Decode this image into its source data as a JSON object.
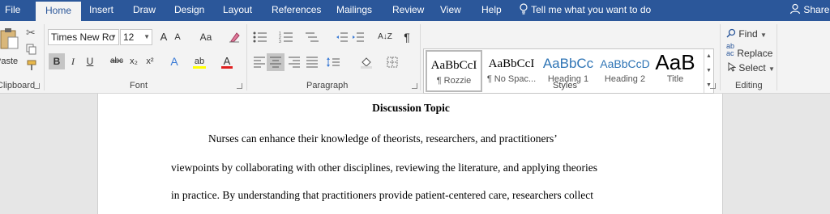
{
  "tabs": [
    "File",
    "Home",
    "Insert",
    "Draw",
    "Design",
    "Layout",
    "References",
    "Mailings",
    "Review",
    "View",
    "Help"
  ],
  "active_tab": "Home",
  "tell_me": "Tell me what you want to do",
  "share": "Share",
  "clipboard": {
    "paste": "Paste",
    "label": "Clipboard"
  },
  "font": {
    "family": "Times New Ro",
    "size": "12",
    "grow": "A",
    "shrink": "A",
    "case": "Aa",
    "bold": "B",
    "italic": "I",
    "underline": "U",
    "strike": "abc",
    "subscript": "x₂",
    "superscript": "x²",
    "font_color": "A",
    "highlight": "ab",
    "text_effects": "A",
    "label": "Font"
  },
  "paragraph": {
    "label": "Paragraph",
    "pilcrow": "¶",
    "sort": "A↓Z"
  },
  "styles": {
    "label": "Styles",
    "items": [
      {
        "preview": "AaBbCcI",
        "name": "¶ Rozzie"
      },
      {
        "preview": "AaBbCcI",
        "name": "¶ No Spac..."
      },
      {
        "preview": "AaBbCc",
        "name": "Heading 1"
      },
      {
        "preview": "AaBbCcD",
        "name": "Heading 2"
      },
      {
        "preview": "AaB",
        "name": "Title"
      }
    ]
  },
  "editing": {
    "find": "Find",
    "replace": "Replace",
    "select": "Select",
    "label": "Editing"
  },
  "document": {
    "title": "Discussion Topic",
    "lines": [
      "Nurses can enhance their knowledge of theorists, researchers, and practitioners’",
      "viewpoints by collaborating with other disciplines, reviewing the literature, and applying theories",
      "in practice. By understanding that practitioners provide patient-centered care, researchers collect"
    ]
  },
  "colors": {
    "accent": "#2b579a",
    "font_color_bar": "#e02020",
    "highlight_bar": "#ffff00"
  }
}
